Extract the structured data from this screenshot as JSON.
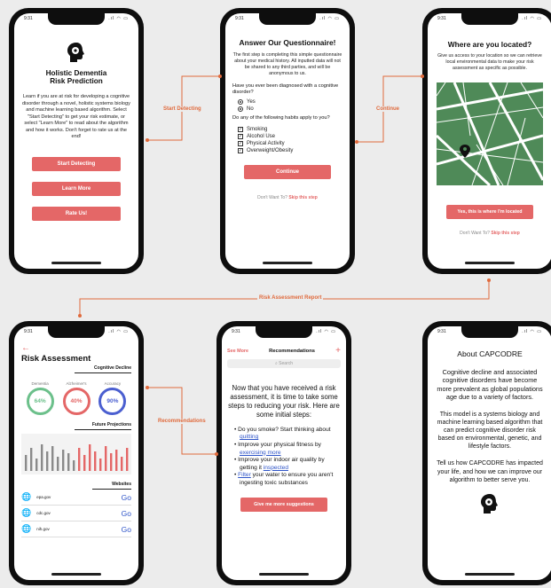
{
  "status": {
    "time": "9:31"
  },
  "flow": {
    "start_detecting": "Start Detecting",
    "continue": "Continue",
    "risk_report": "Risk Assessment Report",
    "recommendations": "Recommendations"
  },
  "screen1": {
    "title_line1": "Holistic Dementia",
    "title_line2": "Risk Prediction",
    "body": "Learn if you are at risk for developing a cognitive disorder through a novel, holistic systems biology and machine learning based algorithm. Select \"Start Detecting\" to get your risk estimate, or select \"Learn More\" to read about the algorithm and how it works. Don't forget to rate us at the end!",
    "btn_start": "Start Detecting",
    "btn_learn": "Learn More",
    "btn_rate": "Rate Us!"
  },
  "screen2": {
    "title": "Answer Our Questionnaire!",
    "intro": "The first step is completing this simple questionnaire about your medical history. All inputted data will not be shared to any third parties, and will be anonymous to us.",
    "q1": "Have you ever been diagnosed with a cognitive disorder?",
    "yes": "Yes",
    "no": "No",
    "q2": "Do any of the following habits apply to you?",
    "habits": [
      "Smoking",
      "Alcohol Use",
      "Physical Activity",
      "Overweight/Obesity"
    ],
    "btn_continue": "Continue",
    "skip_prefix": "Don't Want To?",
    "skip_link": "Skip this step"
  },
  "screen3": {
    "title": "Where are you located?",
    "body": "Give us access to your location so we can retrieve local environmental data to make your risk assessment as specific as possible.",
    "btn_confirm": "Yes, this is where I'm located",
    "skip_prefix": "Don't Want To?",
    "skip_link": "Skip this step"
  },
  "screen4": {
    "back": "←",
    "title": "Risk Assessment",
    "section1": "Cognitive Decline",
    "rings": [
      {
        "label": "Dementia",
        "value": "64%",
        "color": "#6cc08b"
      },
      {
        "label": "Alzheimer's",
        "value": "40%",
        "color": "#e46767"
      },
      {
        "label": "Accuracy",
        "value": "90%",
        "color": "#4b5fd0"
      }
    ],
    "section2": "Future Projections",
    "section3": "Websites",
    "sites": [
      {
        "name": "epa.gov",
        "go": "Go"
      },
      {
        "name": "cdc.gov",
        "go": "Go"
      },
      {
        "name": "nih.gov",
        "go": "Go"
      }
    ]
  },
  "screen5": {
    "see_more": "See More",
    "header": "Recommendations",
    "plus": "+",
    "search_placeholder": "Search",
    "intro": "Now that you have received a risk assessment, it is time to take some steps to reducing your risk. Here are some initial steps:",
    "b1_text": "Do you smoke? Start thinking about ",
    "b1_link": "quitting",
    "b2_text": "Improve your physical fitness by ",
    "b2_link": "exercising more",
    "b3_text": "Improve your indoor air quality by getting it ",
    "b3_link": "inspected",
    "b4_link": "Filter",
    "b4_text": " your water to ensure you aren't ingesting toxic substances",
    "btn_more": "Give me more suggestions"
  },
  "screen6": {
    "title": "About CAPCODRE",
    "p1": "Cognitive decline and associated cognitive disorders have become more prevalent as global populations age due to a variety of factors.",
    "p2": "This model is a systems biology and machine learning based algorithm that can predict cognitive disorder risk based on environmental, genetic, and lifestyle factors.",
    "p3": "Tell us how CAPCODRE has impacted your life, and how we can improve our algorithm to better serve you."
  }
}
